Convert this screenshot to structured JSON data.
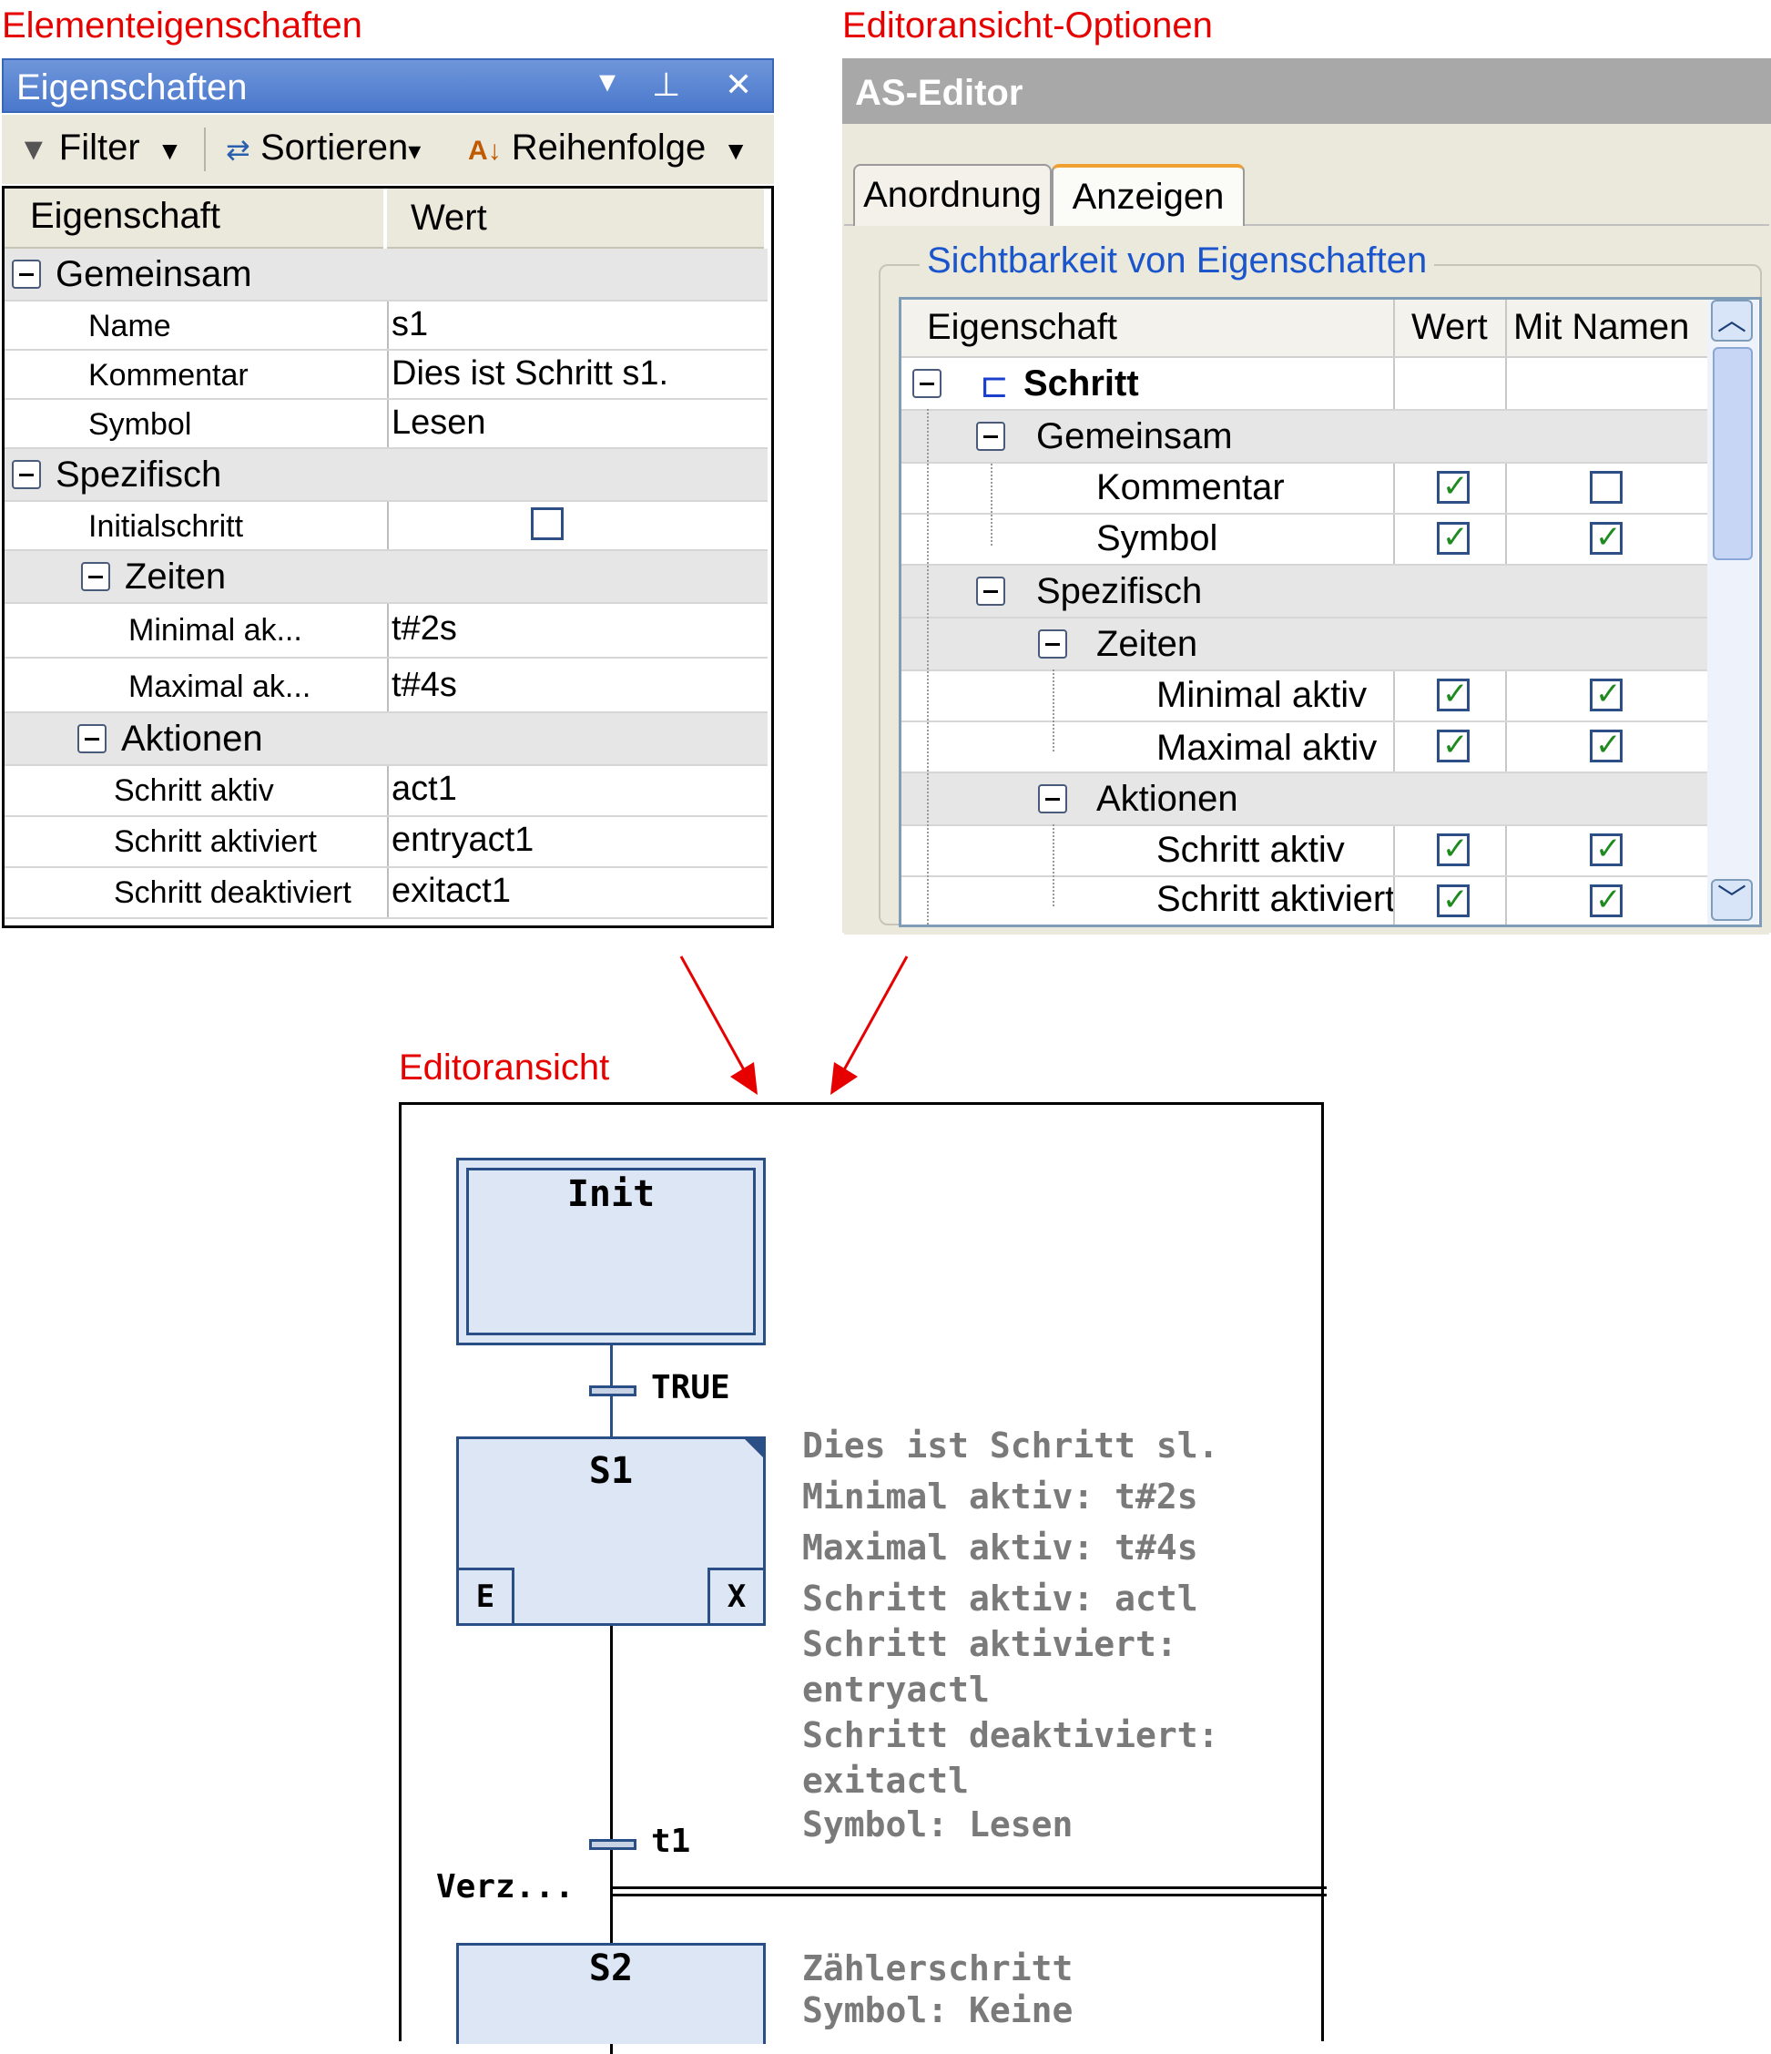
{
  "labels": {
    "element_properties": "Elementeigenschaften",
    "editor_view_options": "Editoransicht-Optionen",
    "editor_view": "Editoransicht"
  },
  "properties_panel": {
    "title": "Eigenschaften",
    "toolbar": {
      "filter": "Filter",
      "sort": "Sortieren",
      "order": "Reihenfolge"
    },
    "header": {
      "property": "Eigenschaft",
      "value": "Wert"
    },
    "groups": {
      "common": "Gemeinsam",
      "specific": "Spezifisch",
      "times": "Zeiten",
      "actions": "Aktionen"
    },
    "rows": {
      "name": {
        "label": "Name",
        "value": "s1"
      },
      "comment": {
        "label": "Kommentar",
        "value": "Dies ist Schritt s1."
      },
      "symbol": {
        "label": "Symbol",
        "value": "Lesen"
      },
      "initial_step": {
        "label": "Initialschritt",
        "checked": false
      },
      "min_active": {
        "label": "Minimal ak...",
        "value": "t#2s"
      },
      "max_active": {
        "label": "Maximal ak...",
        "value": "t#4s"
      },
      "step_active": {
        "label": "Schritt aktiv",
        "value": "act1"
      },
      "step_activated": {
        "label": "Schritt aktiviert",
        "value": "entryact1"
      },
      "step_deactivated": {
        "label": "Schritt deaktiviert",
        "value": "exitact1"
      }
    }
  },
  "editor_options": {
    "title": "AS-Editor",
    "tabs": [
      "Anordnung",
      "Anzeigen"
    ],
    "active_tab": "Anzeigen",
    "group_label": "Sichtbarkeit von Eigenschaften",
    "header": {
      "property": "Eigenschaft",
      "value": "Wert",
      "with_name": "Mit Namen"
    },
    "root": "Schritt",
    "groups": {
      "common": "Gemeinsam",
      "specific": "Spezifisch",
      "times": "Zeiten",
      "actions": "Aktionen"
    },
    "items": {
      "comment": {
        "label": "Kommentar",
        "value": true,
        "with_name": false
      },
      "symbol": {
        "label": "Symbol",
        "value": true,
        "with_name": true
      },
      "min_active": {
        "label": "Minimal aktiv",
        "value": true,
        "with_name": true
      },
      "max_active": {
        "label": "Maximal aktiv",
        "value": true,
        "with_name": true
      },
      "step_active": {
        "label": "Schritt aktiv",
        "value": true,
        "with_name": true
      },
      "step_activated": {
        "label": "Schritt aktiviert",
        "value": true,
        "with_name": true
      }
    }
  },
  "diagram": {
    "init_step": "Init",
    "transition1": "TRUE",
    "step1": "S1",
    "entry": "E",
    "exit": "X",
    "transition2": "t1",
    "branch": "Verz...",
    "step2": "S2",
    "s1_annotations": [
      "Dies ist Schritt sl.",
      "Minimal aktiv: t#2s",
      "Maximal aktiv: t#4s",
      "Schritt aktiv: actl",
      "Schritt aktiviert:",
      "entryactl",
      "Schritt deaktiviert:",
      "exitactl",
      "Symbol: Lesen"
    ],
    "s2_annotations": [
      "Zählerschritt",
      "Symbol: Keine"
    ]
  },
  "colors": {
    "label_red": "#e60000",
    "titlebar_blue": "#4a78cc",
    "link_blue": "#1a55cc",
    "step_fill": "#dde6f4",
    "step_border": "#2a4f86"
  }
}
